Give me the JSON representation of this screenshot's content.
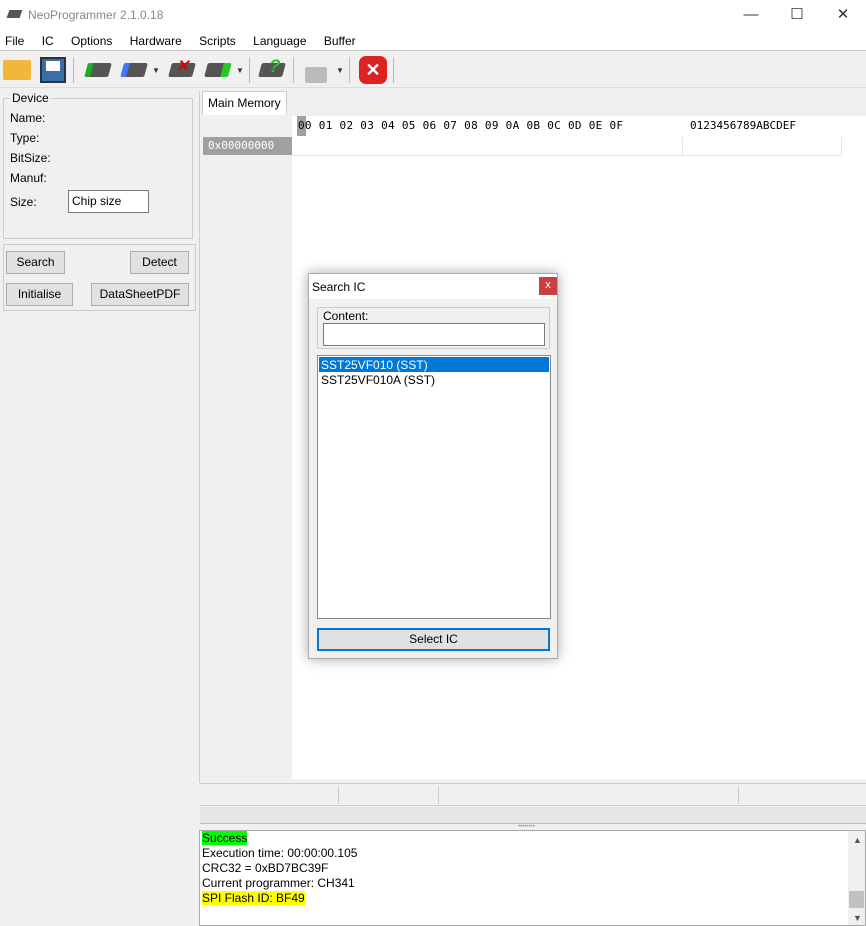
{
  "window": {
    "title": "NeoProgrammer 2.1.0.18",
    "minimize": "—",
    "maximize": "☐",
    "close": "✕"
  },
  "menu": [
    "File",
    "IC",
    "Options",
    "Hardware",
    "Scripts",
    "Language",
    "Buffer"
  ],
  "device": {
    "legend": "Device",
    "name_label": "Name:",
    "type_label": "Type:",
    "bitsize_label": "BitSize:",
    "manuf_label": "Manuf:",
    "size_label": "Size:",
    "size_value": "Chip size"
  },
  "buttons": {
    "search": "Search",
    "detect": "Detect",
    "initialise": "Initialise",
    "datasheet": "DataSheetPDF"
  },
  "tabs": {
    "main": "Main Memory"
  },
  "hex": {
    "header": "00 01 02 03 04 05 06 07 08 09 0A 0B 0C 0D 0E 0F",
    "ascii_header": "0123456789ABCDEF",
    "first_address": "0x00000000"
  },
  "dialog": {
    "title": "Search IC",
    "close": "x",
    "content_label": "Content:",
    "content_value": "",
    "results": [
      "SST25VF010 (SST)",
      "SST25VF010A (SST)"
    ],
    "selected_index": 0,
    "select_button": "Select IC"
  },
  "log": {
    "lines": [
      "Success",
      "Execution time: 00:00:00.105",
      "CRC32 = 0xBD7BC39F",
      "Current programmer: CH341",
      "SPI Flash ID: BF49"
    ],
    "colors": {
      "success": "#00ff00",
      "highlight": "#ffff00"
    }
  }
}
